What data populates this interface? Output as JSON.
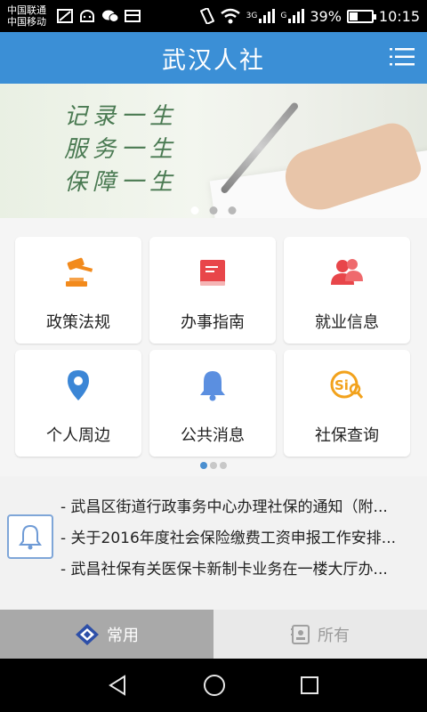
{
  "status_bar": {
    "carrier_1": "中国联通",
    "carrier_2": "中国移动",
    "network_1": "3G",
    "network_2": "G",
    "battery_percent": "39%",
    "battery_level": 0.39,
    "time": "10:15"
  },
  "app_bar": {
    "title": "武汉人社",
    "menu_icon": "hamburger-menu-icon"
  },
  "banner": {
    "lines": [
      "记录一生",
      "服务一生",
      "保障一生"
    ],
    "slide_count": 3,
    "active_slide": 1
  },
  "grid": {
    "items": [
      {
        "label": "政策法规",
        "icon": "gavel-icon",
        "color": "#f28a1c"
      },
      {
        "label": "办事指南",
        "icon": "book-icon",
        "color": "#e8464a"
      },
      {
        "label": "就业信息",
        "icon": "users-icon",
        "color": "#e8464a"
      },
      {
        "label": "个人周边",
        "icon": "location-pin-icon",
        "color": "#3b86d6"
      },
      {
        "label": "公共消息",
        "icon": "bell-icon",
        "color": "#5b8fe0"
      },
      {
        "label": "社保查询",
        "icon": "si-query-icon",
        "color": "#f2a21c"
      }
    ],
    "page_count": 3,
    "active_page": 1
  },
  "news": {
    "items": [
      "- 武昌区街道行政事务中心办理社保的通知（附...",
      "- 关于2016年度社会保险缴费工资申报工作安排...",
      "- 武昌社保有关医保卡新制卡业务在一楼大厅办..."
    ]
  },
  "tabs": {
    "common": "常用",
    "all": "所有"
  },
  "colors": {
    "primary": "#3b8fd6",
    "active_tab": "#a9a9a9"
  }
}
